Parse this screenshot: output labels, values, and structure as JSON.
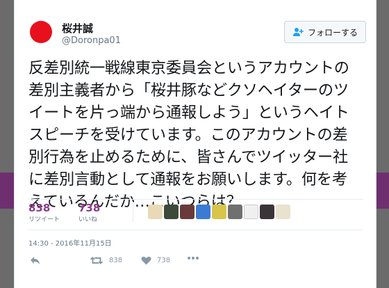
{
  "tweet": {
    "name": "桜井誠",
    "handle": "@Doronpa01",
    "follow_label": "フォローする",
    "text_lines": [
      "反差別統一戦線東京委員会というアカウントの",
      "差別主義者から「桜井豚などクソヘイターのツ",
      "イートを片っ端から通報しよう」というヘイト",
      "スピーチを受けています。このアカウントの差",
      "別行為を止めるために、皆さんでツイッター社",
      "に差別言動として通報をお願いします。何を考",
      "えているんだか…こいつらは？"
    ],
    "retweets": "838",
    "retweets_label": "リツイート",
    "likes": "738",
    "likes_label": "いいね",
    "timestamp": "14:30 - 2016年11月15日",
    "action_retweet_count": "838",
    "action_like_count": "738"
  },
  "colors": {
    "accent": "#8b3a8b",
    "avatar_sun": "#e8101d"
  },
  "icons": {
    "follow": "add-user-icon",
    "reply": "reply-icon",
    "retweet": "retweet-icon",
    "like": "heart-icon",
    "more": "more-icon"
  }
}
